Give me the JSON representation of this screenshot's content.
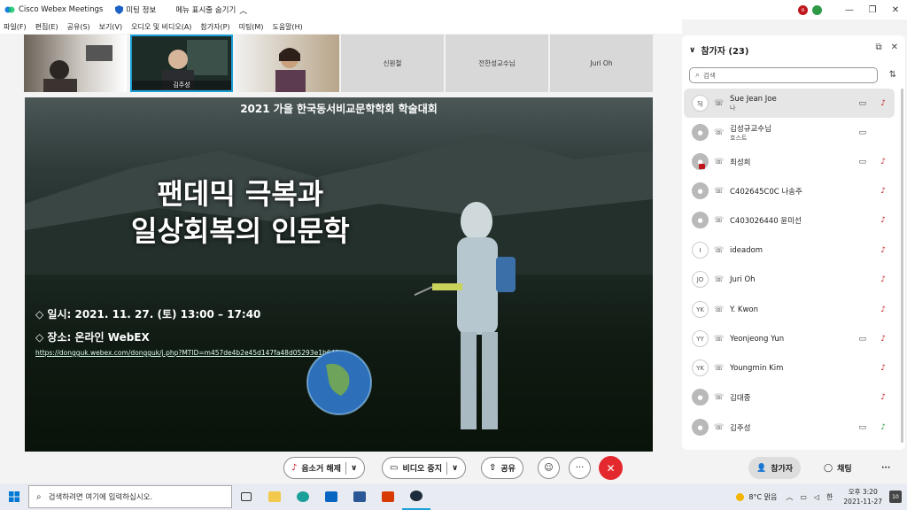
{
  "app": {
    "title": "Cisco Webex Meetings",
    "meeting_info": "미팅 정보",
    "hide_menu": "메뉴 표시줄 숨기기"
  },
  "menubar": {
    "items": [
      "파일(F)",
      "편집(E)",
      "공유(S)",
      "보기(V)",
      "오디오 및 비디오(A)",
      "참가자(P)",
      "미팅(M)",
      "도움말(H)"
    ]
  },
  "thumbnails": [
    {
      "name": "",
      "type": "video"
    },
    {
      "name": "김주성",
      "type": "video"
    },
    {
      "name": "",
      "type": "video"
    },
    {
      "name": "신원철",
      "type": "name"
    },
    {
      "name": "전한성교수님",
      "type": "name"
    },
    {
      "name": "Juri Oh",
      "type": "name"
    }
  ],
  "slide": {
    "conference": "2021 가을 한국동서비교문학학회 학술대회",
    "headline1": "팬데믹 극복과",
    "headline2": "일상회복의 인문학",
    "date": "◇ 일시: 2021. 11. 27. (토) 13:00 – 17:40",
    "place": "◇ 장소: 온라인 WebEX",
    "link": "https://dongguk.webex.com/dongguk/j.php?MTID=m457de4b2e45d147fa48d05293e1b641a",
    "thumb_text": "팬데믹\n일상회복"
  },
  "participants": {
    "header": "참가자 (23)",
    "search_placeholder": "검색",
    "list": [
      {
        "initials": "SJ",
        "name": "Sue Jean Joe",
        "role": "나",
        "cam": true,
        "mic": "muted",
        "me": true
      },
      {
        "initials": "",
        "name": "김성규교수님",
        "role": "호스트",
        "cam": true,
        "mic": "none"
      },
      {
        "initials": "",
        "name": "최성희",
        "role": "",
        "cam": true,
        "mic": "muted",
        "badge": true
      },
      {
        "initials": "",
        "name": "C402645C0C 나송주",
        "role": "",
        "cam": false,
        "mic": "muted"
      },
      {
        "initials": "",
        "name": "C403026440 윤미선",
        "role": "",
        "cam": false,
        "mic": "muted"
      },
      {
        "initials": "I",
        "name": "ideadom",
        "role": "",
        "cam": false,
        "mic": "muted"
      },
      {
        "initials": "JO",
        "name": "Juri Oh",
        "role": "",
        "cam": false,
        "mic": "muted"
      },
      {
        "initials": "YK",
        "name": "Y. Kwon",
        "role": "",
        "cam": false,
        "mic": "muted"
      },
      {
        "initials": "YY",
        "name": "Yeonjeong Yun",
        "role": "",
        "cam": true,
        "mic": "muted"
      },
      {
        "initials": "YK",
        "name": "Youngmin Kim",
        "role": "",
        "cam": false,
        "mic": "muted"
      },
      {
        "initials": "",
        "name": "김대중",
        "role": "",
        "cam": false,
        "mic": "muted"
      },
      {
        "initials": "",
        "name": "김주성",
        "role": "",
        "cam": true,
        "mic": "on"
      }
    ]
  },
  "controls": {
    "unmute": "음소거 해제",
    "stop_video": "비디오 중지",
    "share": "공유",
    "participants": "참가자",
    "chat": "채팅"
  },
  "taskbar": {
    "search_placeholder": "검색하려면 여기에 입력하십시오.",
    "weather": "8°C  맑음",
    "ime": "한",
    "time": "오후 3:20",
    "date": "2021-11-27",
    "notifications": "10"
  },
  "colors": {
    "accent": "#1a9fd8",
    "end_call": "#e3282e",
    "muted": "#c0171d"
  }
}
